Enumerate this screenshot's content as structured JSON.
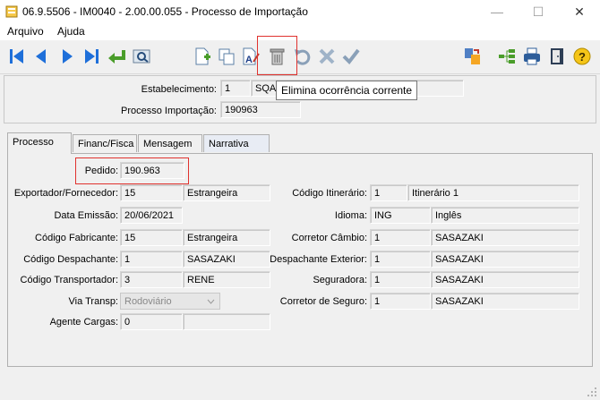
{
  "window": {
    "title": "06.9.5506 - IM0040 - 2.00.00.055 - Processo de Importação",
    "minimize": "—",
    "maximize": "☐",
    "close": "✕"
  },
  "menu": {
    "items": [
      "Arquivo",
      "Ajuda"
    ]
  },
  "toolbar": {
    "buttons": [
      "first-icon",
      "prev-icon",
      "next-icon",
      "last-icon",
      "goto-icon",
      "search-icon",
      "new-icon",
      "copy-icon",
      "edit-icon",
      "delete-icon",
      "undo-icon",
      "cancel-icon",
      "save-icon",
      "related-icon",
      "tree-icon",
      "print-icon",
      "exit-icon",
      "help-icon"
    ]
  },
  "tooltip": "Elimina ocorrência corrente",
  "header": {
    "estabelecimento_label": "Estabelecimento:",
    "estabelecimento_code": "1",
    "estabelecimento_name": "SQA",
    "processo_label": "Processo Importação:",
    "processo_value": "190963"
  },
  "tabs": [
    "Processo",
    "Financ/Fisca",
    "Mensagem",
    "Narrativa"
  ],
  "form": {
    "pedido_label": "Pedido:",
    "pedido_value": "190.963",
    "exportador_label": "Exportador/Fornecedor:",
    "exportador_code": "15",
    "exportador_name": "Estrangeira",
    "data_emissao_label": "Data Emissão:",
    "data_emissao_value": "20/06/2021",
    "fabricante_label": "Código Fabricante:",
    "fabricante_code": "15",
    "fabricante_name": "Estrangeira",
    "despachante_label": "Código Despachante:",
    "despachante_code": "1",
    "despachante_name": "SASAZAKI",
    "transportador_label": "Código Transportador:",
    "transportador_code": "3",
    "transportador_name": "RENE",
    "via_transp_label": "Via Transp:",
    "via_transp_value": "Rodoviário",
    "agente_label": "Agente Cargas:",
    "agente_code": "0",
    "agente_name": "",
    "itinerario_label": "Código Itinerário:",
    "itinerario_code": "1",
    "itinerario_name": "Itinerário 1",
    "idioma_label": "Idioma:",
    "idioma_code": "ING",
    "idioma_name": "Inglês",
    "corretor_cambio_label": "Corretor Câmbio:",
    "corretor_cambio_code": "1",
    "corretor_cambio_name": "SASAZAKI",
    "desp_exterior_label": "Despachante Exterior:",
    "desp_exterior_code": "1",
    "desp_exterior_name": "SASAZAKI",
    "seguradora_label": "Seguradora:",
    "seguradora_code": "1",
    "seguradora_name": "SASAZAKI",
    "corretor_seguro_label": "Corretor de Seguro:",
    "corretor_seguro_code": "1",
    "corretor_seguro_name": "SASAZAKI"
  },
  "colors": {
    "nav_blue": "#1e6fd9",
    "highlight_red": "#e0322e",
    "ok_green": "#4a9d2a"
  }
}
